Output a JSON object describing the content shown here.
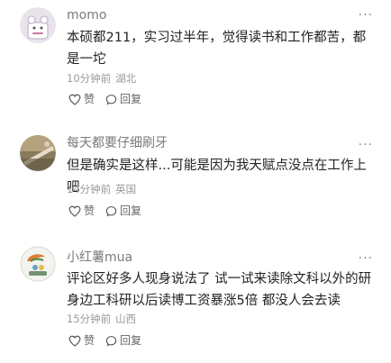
{
  "comments": [
    {
      "username": "momo",
      "more_icon": "more-icon",
      "text": "本硕都211，实习过半年，觉得读书和工作都苦，都是一坨",
      "time": "10分钟前",
      "location": "湖北",
      "like_label": "赞",
      "reply_label": "回复"
    },
    {
      "username": "每天都要仔细刷牙",
      "more_icon": "more-icon",
      "text": "但是确实是这样...可能是因为我天赋点没点在工作上吧",
      "time": "14分钟前",
      "location": "英国",
      "like_label": "赞",
      "reply_label": "回复"
    },
    {
      "username": "小红薯mua",
      "more_icon": "more-icon",
      "text": "评论区好多人现身说法了 试一试来读除文科以外的研身边工科研以后读博工资暴涨5倍 都没人会去读",
      "time": "15分钟前",
      "location": "山西",
      "like_label": "赞",
      "reply_label": "回复"
    }
  ],
  "colors": {
    "username": "#7a7a7a",
    "text": "#222222",
    "meta": "#999999"
  }
}
